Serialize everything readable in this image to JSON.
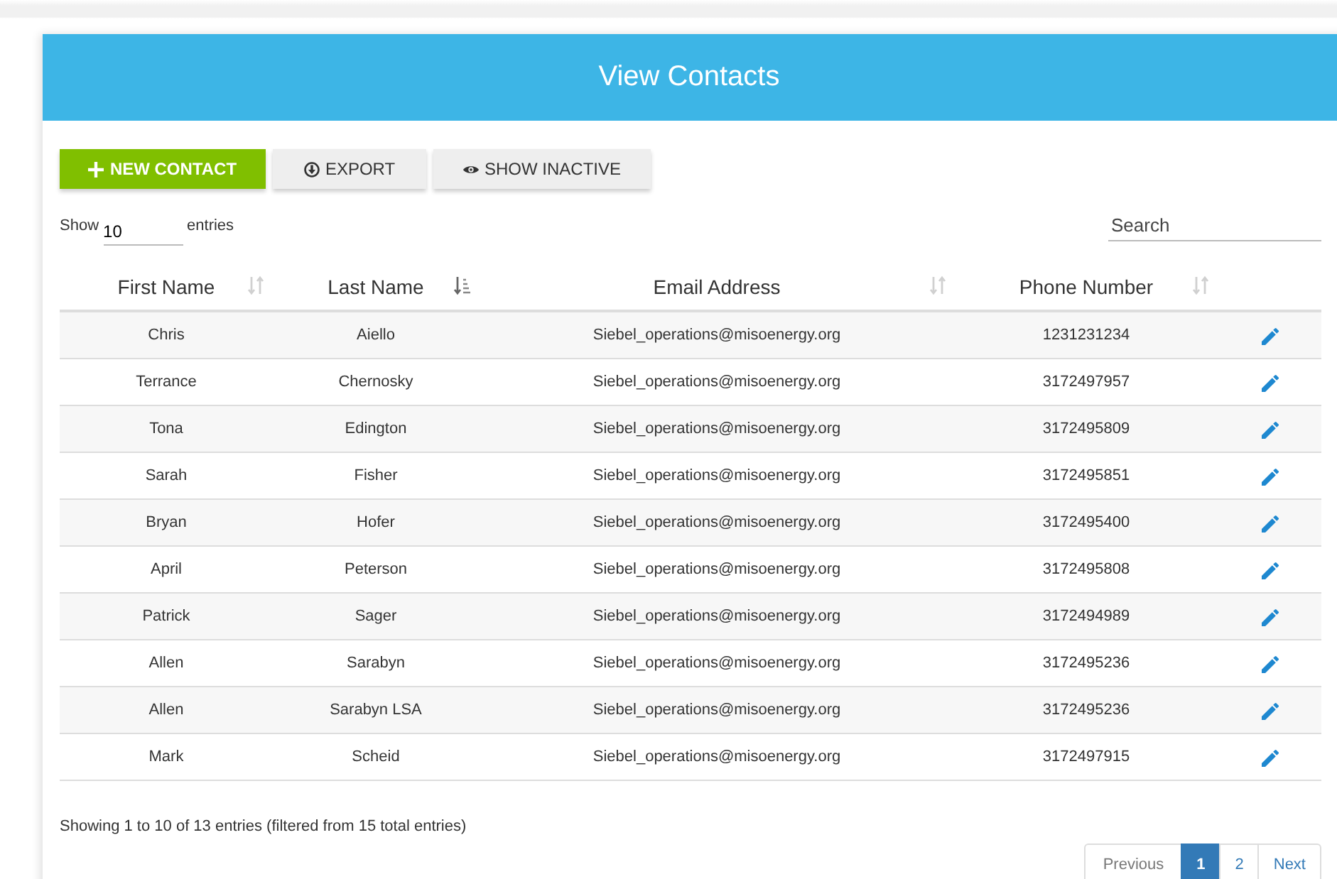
{
  "header": {
    "title": "View Contacts"
  },
  "toolbar": [
    {
      "label": "NEW CONTACT",
      "kind": "primary"
    },
    {
      "label": "EXPORT",
      "kind": "default"
    },
    {
      "label": "SHOW INACTIVE",
      "kind": "default"
    }
  ],
  "length": {
    "before": "Show",
    "value": "10",
    "after": "entries"
  },
  "search": {
    "placeholder": "Search"
  },
  "table": {
    "columns": [
      {
        "label": "First Name",
        "sorted": false
      },
      {
        "label": "Last Name",
        "sorted": true
      },
      {
        "label": "Email Address",
        "sorted": false
      },
      {
        "label": "Phone Number",
        "sorted": false
      }
    ],
    "rows": [
      {
        "first": "Chris",
        "last": "Aiello",
        "email": "Siebel_operations@misoenergy.org",
        "phone": "1231231234"
      },
      {
        "first": "Terrance",
        "last": "Chernosky",
        "email": "Siebel_operations@misoenergy.org",
        "phone": "3172497957"
      },
      {
        "first": "Tona",
        "last": "Edington",
        "email": "Siebel_operations@misoenergy.org",
        "phone": "3172495809"
      },
      {
        "first": "Sarah",
        "last": "Fisher",
        "email": "Siebel_operations@misoenergy.org",
        "phone": "3172495851"
      },
      {
        "first": "Bryan",
        "last": "Hofer",
        "email": "Siebel_operations@misoenergy.org",
        "phone": "3172495400"
      },
      {
        "first": "April",
        "last": "Peterson",
        "email": "Siebel_operations@misoenergy.org",
        "phone": "3172495808"
      },
      {
        "first": "Patrick",
        "last": "Sager",
        "email": "Siebel_operations@misoenergy.org",
        "phone": "3172494989"
      },
      {
        "first": "Allen",
        "last": "Sarabyn",
        "email": "Siebel_operations@misoenergy.org",
        "phone": "3172495236"
      },
      {
        "first": "Allen",
        "last": "Sarabyn LSA",
        "email": "Siebel_operations@misoenergy.org",
        "phone": "3172495236"
      },
      {
        "first": "Mark",
        "last": "Scheid",
        "email": "Siebel_operations@misoenergy.org",
        "phone": "3172497915"
      }
    ]
  },
  "info": "Showing 1 to 10 of 13 entries (filtered from 15 total entries)",
  "pagination": {
    "previous": "Previous",
    "pages": [
      {
        "label": "1",
        "selected": true
      },
      {
        "label": "2",
        "selected": false
      }
    ],
    "next": "Next"
  }
}
